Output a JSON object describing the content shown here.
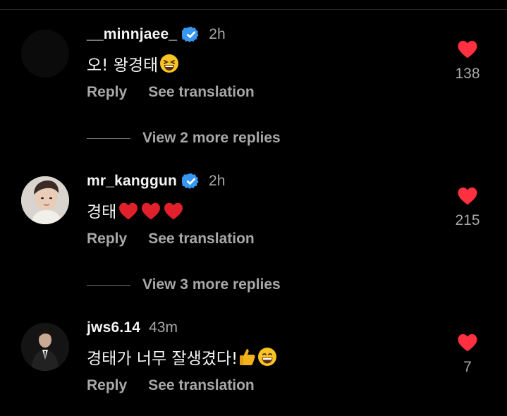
{
  "colors": {
    "background": "#000000",
    "text": "#f5f5f5",
    "muted": "#a8a8a8",
    "like": "#ff3040",
    "verified": "#3797f0"
  },
  "comments": [
    {
      "username": "__minnjaee_",
      "verified": true,
      "time": "2h",
      "text": "오! 왕경태",
      "emoji": "grinning-squinting-face",
      "reply_label": "Reply",
      "translation_label": "See translation",
      "likes": "138"
    },
    {
      "username": "mr_kanggun",
      "verified": true,
      "time": "2h",
      "text": "경태",
      "emoji": "red-heart x3",
      "reply_label": "Reply",
      "translation_label": "See translation",
      "likes": "215"
    },
    {
      "username": "jws6.14",
      "verified": false,
      "time": "43m",
      "text": "경태가 너무 잘생겼다!",
      "emoji": "thumbs-up, grinning-face",
      "reply_label": "Reply",
      "translation_label": "See translation",
      "likes": "7"
    }
  ],
  "view_more": [
    {
      "label": "View 2 more replies"
    },
    {
      "label": "View 3 more replies"
    }
  ]
}
